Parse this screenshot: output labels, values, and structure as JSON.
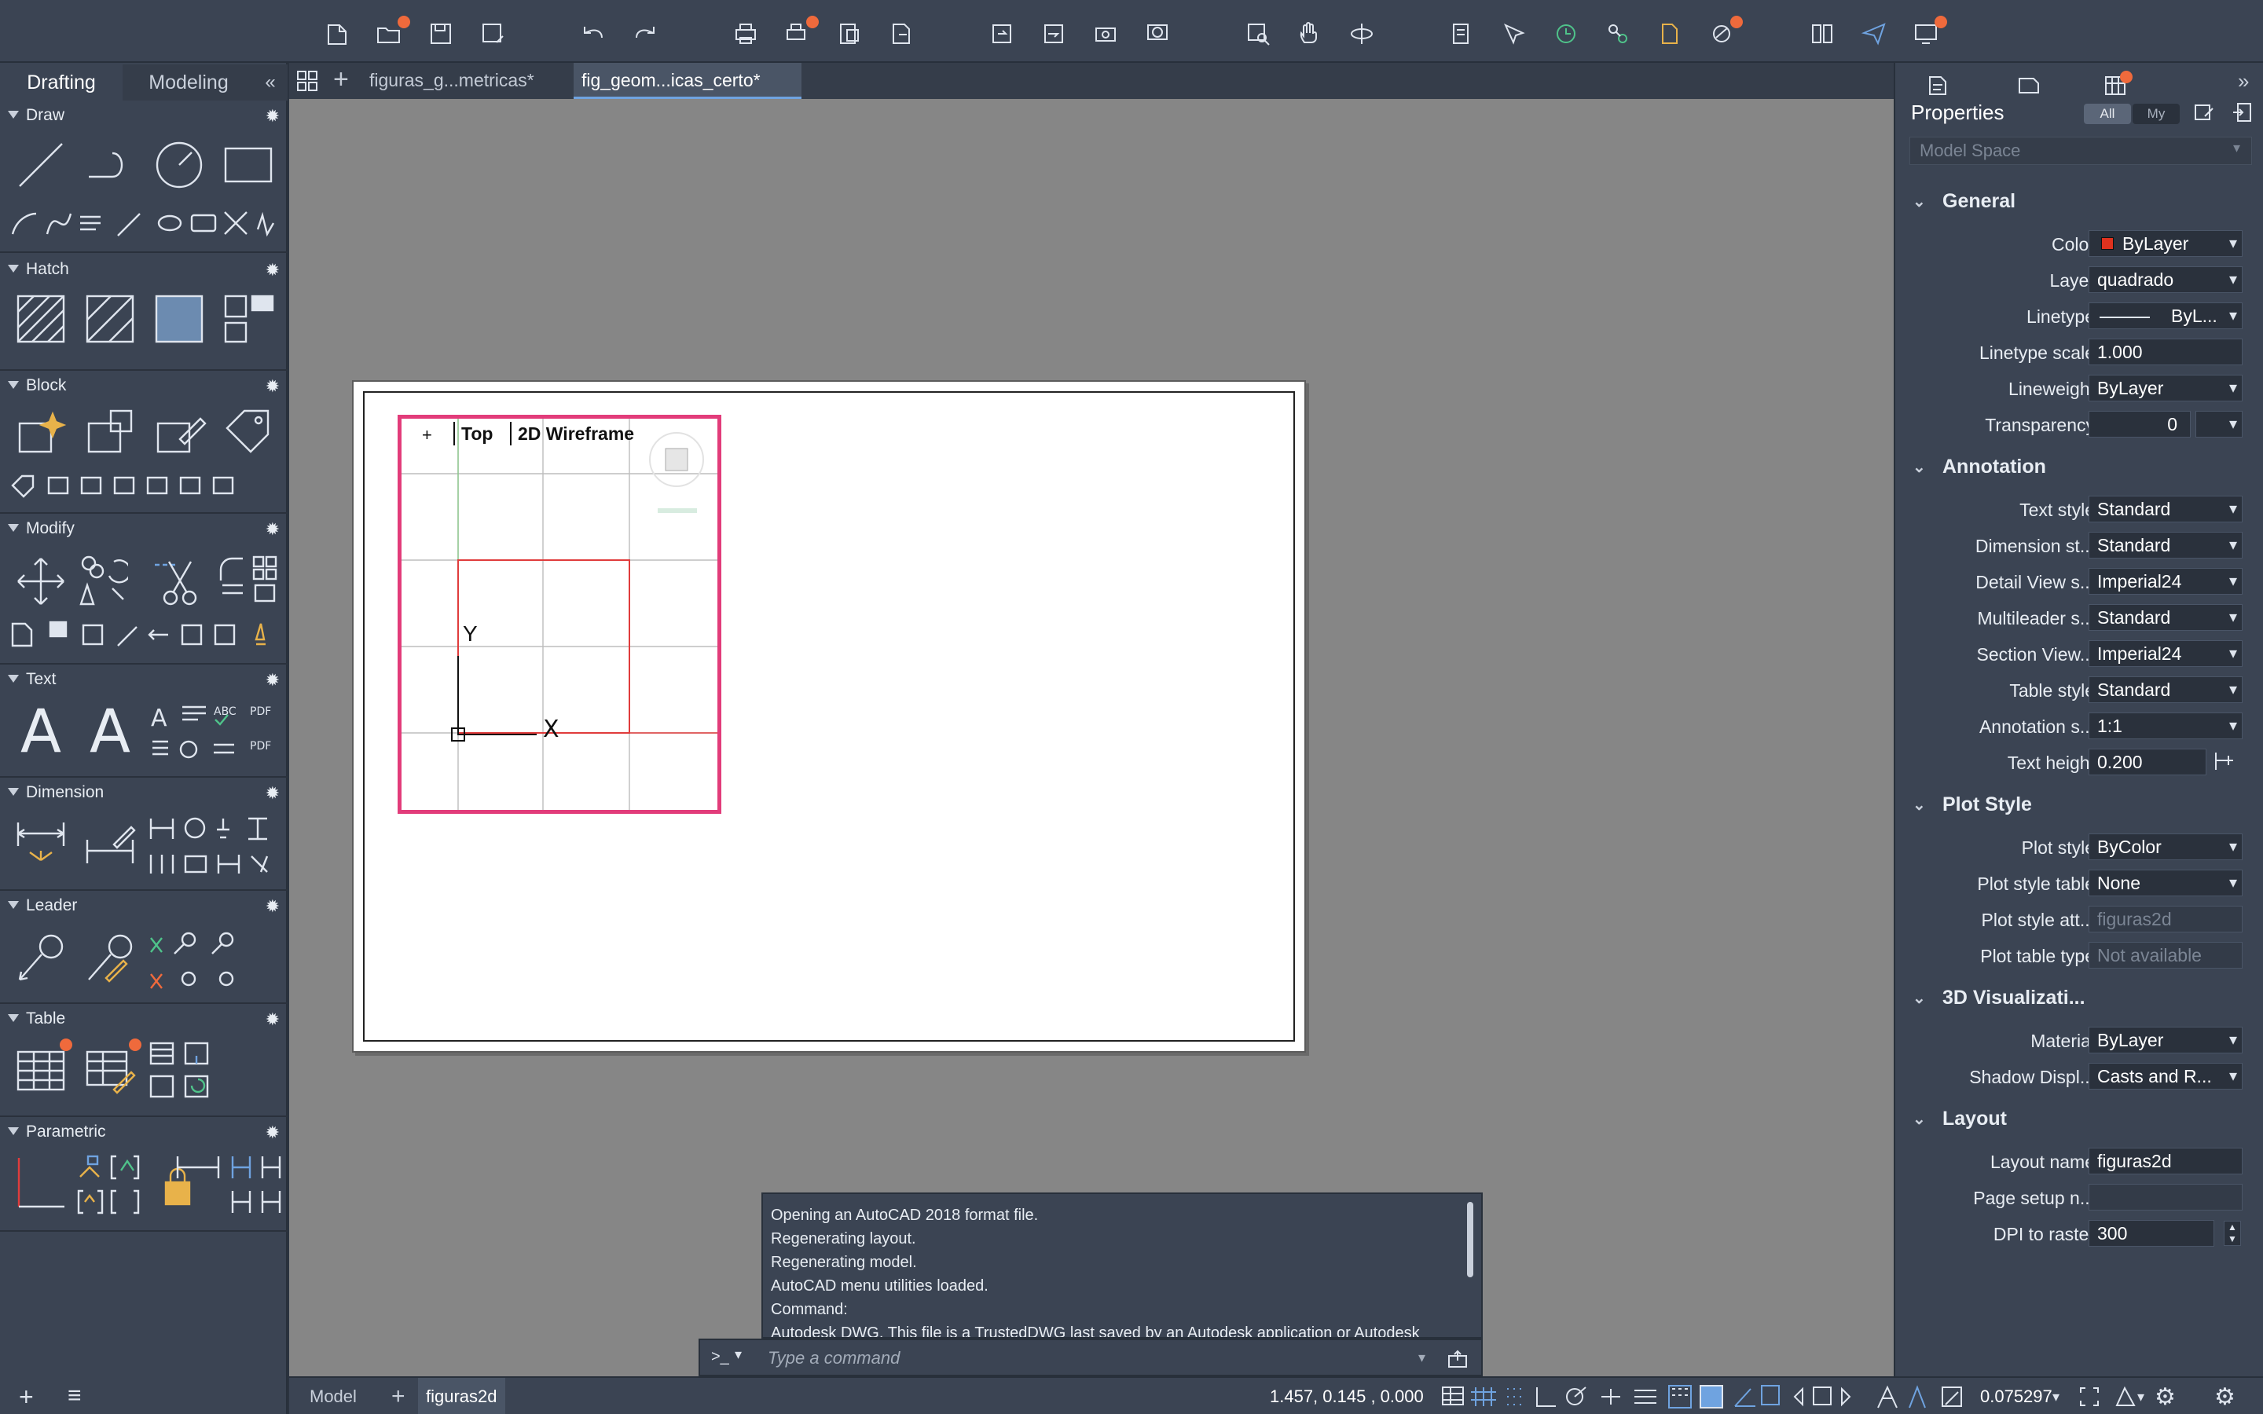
{
  "palette": {
    "tabs": [
      "Drafting",
      "Modeling"
    ],
    "collapse_glyph": "«",
    "sections": [
      "Draw",
      "Hatch",
      "Block",
      "Modify",
      "Text",
      "Dimension",
      "Leader",
      "Table",
      "Parametric"
    ],
    "bottom_add": "+",
    "bottom_menu": "≡"
  },
  "filetabs": {
    "tab1": "figuras_g...metricas*",
    "tab2": "fig_geom...icas_certo*",
    "add": "+"
  },
  "viewport": {
    "plus": "+",
    "view": "Top",
    "style": "2D Wireframe",
    "y_axis": "Y",
    "x_axis": "X"
  },
  "properties": {
    "title": "Properties",
    "filter_all": "All",
    "filter_my": "My",
    "space": "Model Space",
    "groups": {
      "general": "General",
      "annotation": "Annotation",
      "plot_style": "Plot Style",
      "visualization": "3D Visualizati...",
      "layout": "Layout"
    },
    "rows": {
      "color": {
        "label": "Color",
        "value": "ByLayer"
      },
      "layer": {
        "label": "Layer",
        "value": "quadrado"
      },
      "linetype": {
        "label": "Linetype",
        "value": "ByL..."
      },
      "linetype_scale": {
        "label": "Linetype scale",
        "value": "1.000"
      },
      "lineweight": {
        "label": "Lineweight",
        "value": "ByLayer"
      },
      "transparency": {
        "label": "Transparency",
        "value": "0"
      },
      "text_style": {
        "label": "Text style",
        "value": "Standard"
      },
      "dimension_style": {
        "label": "Dimension st...",
        "value": "Standard"
      },
      "detail_view": {
        "label": "Detail View s...",
        "value": "Imperial24"
      },
      "multileader": {
        "label": "Multileader s...",
        "value": "Standard"
      },
      "section_view": {
        "label": "Section View...",
        "value": "Imperial24"
      },
      "table_style": {
        "label": "Table style",
        "value": "Standard"
      },
      "annotation_scale": {
        "label": "Annotation s...",
        "value": "1:1"
      },
      "text_height": {
        "label": "Text height",
        "value": "0.200"
      },
      "plot_style": {
        "label": "Plot style",
        "value": "ByColor"
      },
      "plot_style_table": {
        "label": "Plot style table",
        "value": "None"
      },
      "plot_style_att": {
        "label": "Plot style att...",
        "value": "figuras2d"
      },
      "plot_table_type": {
        "label": "Plot table type",
        "value": "Not available"
      },
      "material": {
        "label": "Material",
        "value": "ByLayer"
      },
      "shadow": {
        "label": "Shadow Displ...",
        "value": "Casts and R..."
      },
      "layout_name": {
        "label": "Layout name",
        "value": "figuras2d"
      },
      "page_setup": {
        "label": "Page setup n...",
        "value": ""
      },
      "dpi": {
        "label": "DPI to raster",
        "value": "300"
      }
    },
    "color_swatch": "#e0321e"
  },
  "command": {
    "history": [
      "Opening an AutoCAD 2018 format file.",
      "Regenerating layout.",
      "Regenerating model.",
      "AutoCAD menu utilities loaded.",
      "Command:",
      "Autodesk DWG.  This file is a TrustedDWG last saved by an Autodesk application or Autodesk"
    ],
    "prompt": ">_",
    "placeholder": "Type a command"
  },
  "status": {
    "model_tab": "Model",
    "add": "+",
    "layout_tab": "figuras2d",
    "coordinates": "1.457,  0.145 , 0.000",
    "scale": "0.075297"
  },
  "colors": {
    "accent": "#6fa3e0",
    "badge": "#ef6a3c",
    "viewport_border": "#e23c7a",
    "rectangle": "#e03c3c"
  }
}
